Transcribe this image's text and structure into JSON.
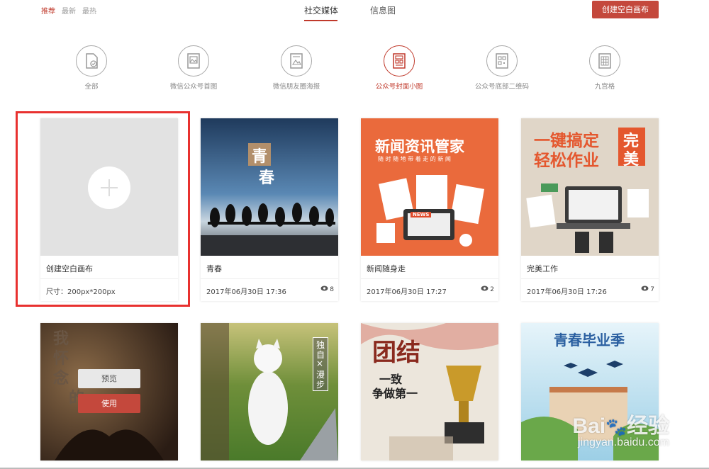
{
  "sort_tabs": [
    "推荐",
    "最新",
    "最热"
  ],
  "type_tabs": [
    "社交媒体",
    "信息图"
  ],
  "create_button": "创建空白画布",
  "categories": [
    {
      "label": "全部",
      "icon": "doc-check-icon"
    },
    {
      "label": "微信公众号首图",
      "icon": "image-frame-icon"
    },
    {
      "label": "微信朋友圈海报",
      "icon": "poster-icon"
    },
    {
      "label": "公众号封面小图",
      "icon": "cover-grid-icon"
    },
    {
      "label": "公众号底部二维码",
      "icon": "qrcode-icon"
    },
    {
      "label": "九宫格",
      "icon": "nine-grid-icon"
    }
  ],
  "blank_card": {
    "name": "创建空白画布",
    "size": "尺寸：200px*200px"
  },
  "cards": [
    {
      "name": "青春",
      "date": "2017年06月30日 17:36",
      "views": "8",
      "thumb_text": [
        "青",
        "春"
      ]
    },
    {
      "name": "新闻随身走",
      "date": "2017年06月30日 17:27",
      "views": "2",
      "thumb_title": "新闻资讯管家",
      "thumb_sub": "随 时 随 地 带 着 走 的 新 闻",
      "thumb_badge": "NEWS"
    },
    {
      "name": "完美工作",
      "date": "2017年06月30日 17:26",
      "views": "7",
      "thumb_line1": "一键搞定",
      "thumb_line2": "轻松作业",
      "thumb_tag1": "完",
      "thumb_tag2": "美"
    }
  ],
  "row2": {
    "overlay_preview": "预览",
    "overlay_use": "使用",
    "card1_text": [
      "我",
      "怀",
      "念",
      "的"
    ],
    "card2_text": [
      "独",
      "自",
      "×",
      "漫",
      "步"
    ],
    "card3_title": "团结",
    "card3_sub": [
      "一致",
      "争做第一"
    ],
    "card4_title": "青春毕业季"
  },
  "watermark": {
    "brand": "Bai",
    "brand2": "经验",
    "url": "jingyan.baidu.com"
  },
  "colors": {
    "accent": "#c0392b",
    "button": "#c4483c",
    "highlight": "#e8312f"
  }
}
